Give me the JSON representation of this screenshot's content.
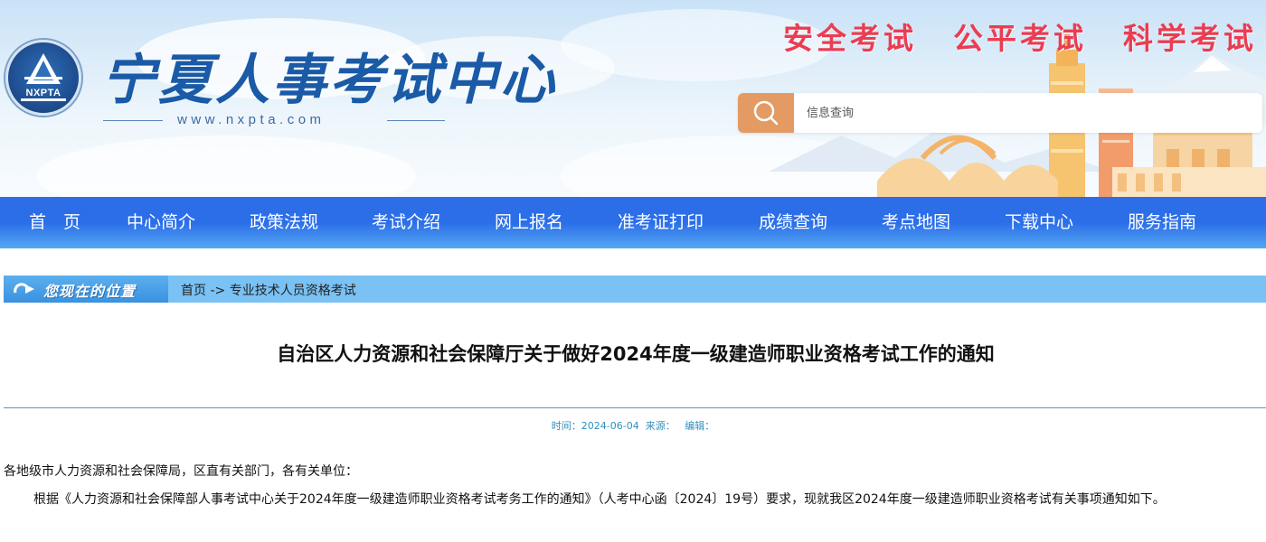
{
  "header": {
    "logo_abbr": "NXPTA",
    "site_title": "宁夏人事考试中心",
    "site_url": "www.nxpta.com",
    "slogans": [
      "安全考试",
      "公平考试",
      "科学考试"
    ],
    "slogan_color": "#ea3d52",
    "brand_color": "#1a5aa6"
  },
  "search": {
    "placeholder": "信息查询",
    "icon": "search-icon",
    "button_color": "#e39a63"
  },
  "nav": {
    "items": [
      "首　页",
      "中心简介",
      "政策法规",
      "考试介绍",
      "网上报名",
      "准考证打印",
      "成绩查询",
      "考点地图",
      "下载中心",
      "服务指南"
    ],
    "bar_color": "#2e6de6"
  },
  "breadcrumb": {
    "tag": "您现在的位置",
    "home": "首页",
    "separator": "->",
    "current": "专业技术人员资格考试"
  },
  "article": {
    "title": "自治区人力资源和社会保障厅关于做好2024年度一级建造师职业资格考试工作的通知",
    "meta_time_label": "时间：",
    "meta_time": "2024-06-04",
    "meta_source_label": "来源：",
    "meta_editor_label": "编辑：",
    "greeting": "各地级市人力资源和社会保障局，区直有关部门，各有关单位：",
    "paragraph_1": "根据《人力资源和社会保障部人事考试中心关于2024年度一级建造师职业资格考试考务工作的通知》（人考中心函〔2024〕19号）要求，现就我区2024年度一级建造师职业资格考试有关事项通知如下。"
  }
}
